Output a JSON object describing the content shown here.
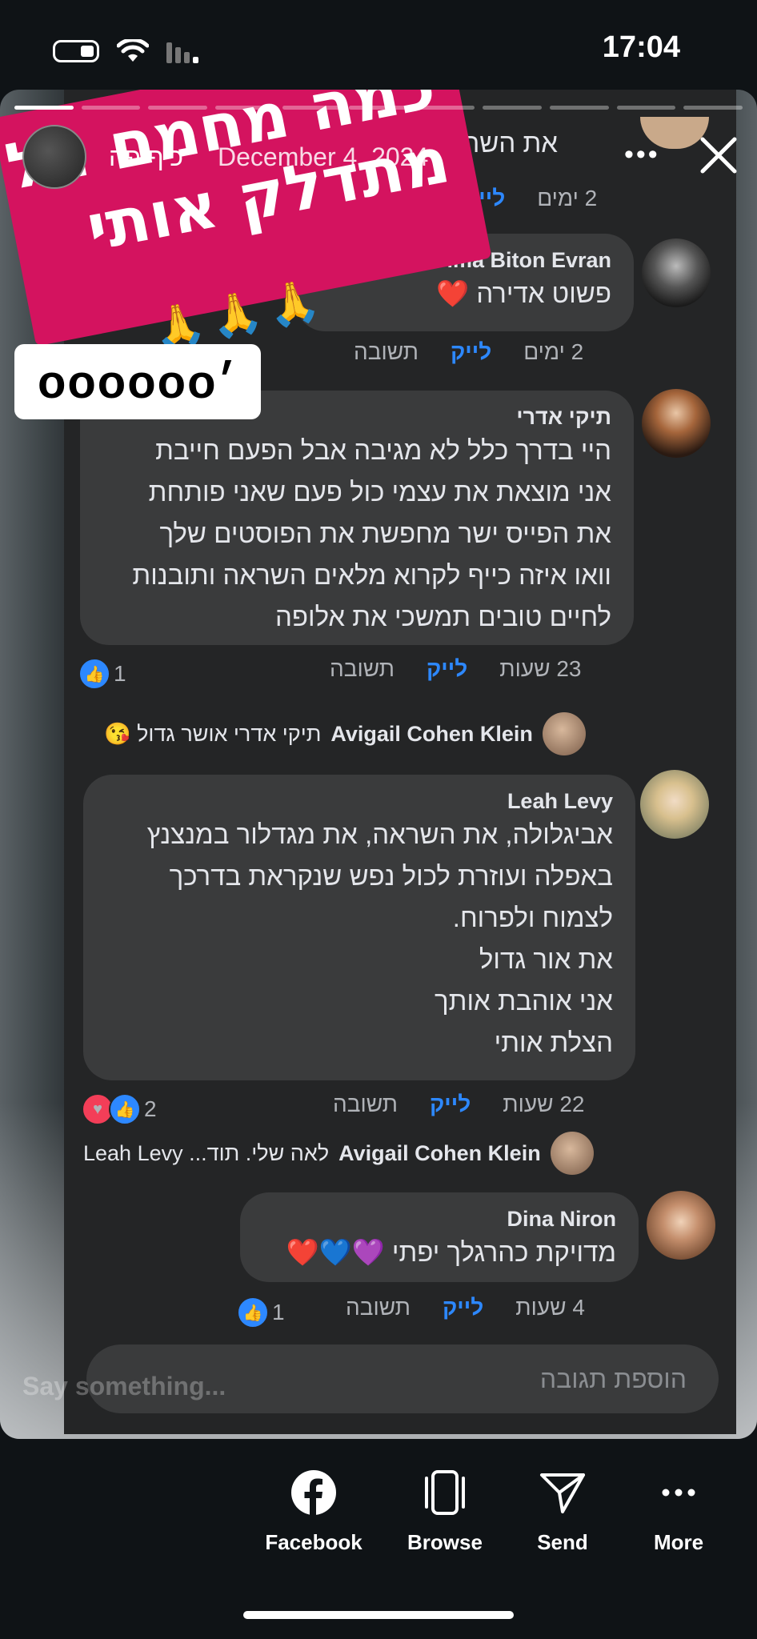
{
  "status_bar": {
    "time": "17:04"
  },
  "story": {
    "author": "כיף פה",
    "date": "December 4, 2024",
    "sticker_text_line1": "כמה מחמם תל",
    "sticker_text_line2": "מתדלק אותי",
    "sticker_emoji": "🙏🙏🙏",
    "label_text": "oooooo׳",
    "say_something": "Say something..."
  },
  "fb": {
    "top_partial": {
      "text": "את השראה",
      "meta_time": "2 ימים",
      "meta_like": "לייק"
    },
    "comments": [
      {
        "name": "ima Biton Evran",
        "text": "פשוט אדירה ❤️",
        "meta_time": "2 ימים",
        "meta_like": "לייק",
        "meta_reply": "תשובה"
      },
      {
        "name": "תיקי אדרי",
        "text": "היי בדרך כלל לא מגיבה אבל הפעם חייבת\nאני מוצאת את עצמי כול פעם שאני פותחת\nאת הפייס ישר מחפשת את הפוסטים שלך\nוואו איזה כייף לקרוא מלאים השראה ותובנות\nלחיים טובים תמשכי את אלופה",
        "meta_time": "23 שעות",
        "meta_like": "לייק",
        "meta_reply": "תשובה",
        "reactions_count": "1",
        "reply": {
          "name": "Avigail Cohen Klein",
          "text": "תיקי אדרי אושר גדול 😘"
        }
      },
      {
        "name": "Leah Levy",
        "text": "אביגלולה, את השראה, את מגדלור במנצנץ\nבאפלה ועוזרת לכול נפש שנקראת בדרכך\nלצמוח ולפרוח.\nאת אור גדול\nאני אוהבת אותך\nהצלת אותי",
        "meta_time": "22 שעות",
        "meta_like": "לייק",
        "meta_reply": "תשובה",
        "reactions_count": "2",
        "reply": {
          "name": "Avigail Cohen Klein",
          "text": "לאה שלי. תוד... Leah Levy"
        }
      },
      {
        "name": "Dina Niron",
        "text": "מדויקת כהרגלך יפתי 💜💙❤️",
        "meta_time": "4 שעות",
        "meta_like": "לייק",
        "meta_reply": "תשובה",
        "reactions_count": "1"
      }
    ],
    "composer_placeholder": "הוספת תגובה"
  },
  "actions": [
    {
      "label": "Facebook",
      "icon": "facebook-icon"
    },
    {
      "label": "Browse",
      "icon": "browse-icon"
    },
    {
      "label": "Send",
      "icon": "send-icon"
    },
    {
      "label": "More",
      "icon": "more-icon"
    }
  ],
  "colors": {
    "sticker": "#d4135f",
    "link_blue": "#2d88ff",
    "bubble": "#3a3b3c",
    "fb_bg": "#242526"
  }
}
